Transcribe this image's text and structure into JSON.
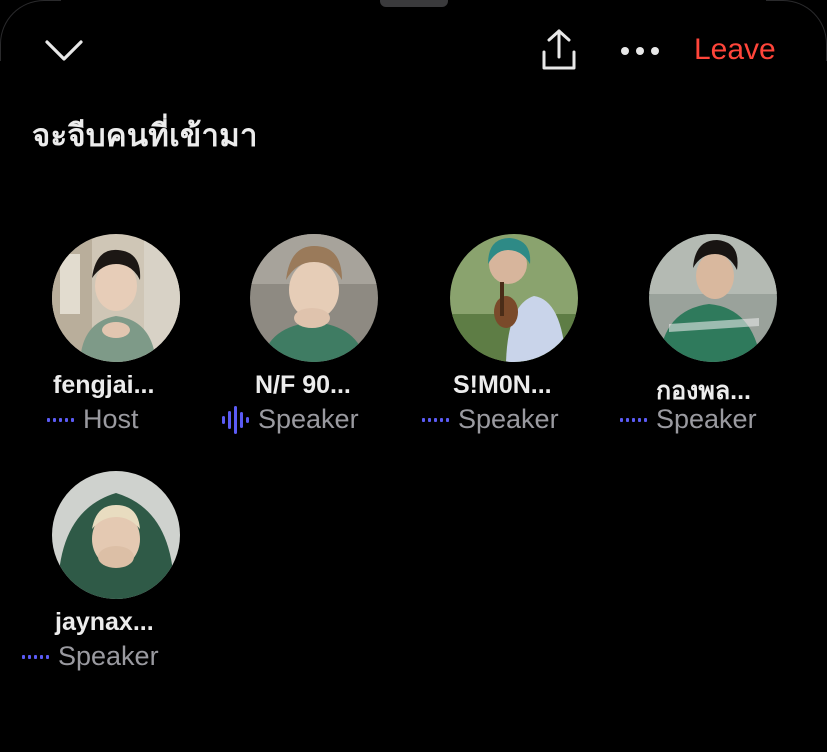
{
  "header": {
    "leave_label": "Leave"
  },
  "room": {
    "title": "จะจีบคนที่เข้ามา"
  },
  "participants": [
    {
      "name": "fengjai...",
      "role": "Host",
      "speaking": false
    },
    {
      "name": "N/F 90...",
      "role": "Speaker",
      "speaking": true
    },
    {
      "name": "S!M0N...",
      "role": "Speaker",
      "speaking": false
    },
    {
      "name": "กองพล...",
      "role": "Speaker",
      "speaking": false
    },
    {
      "name": "jaynax...",
      "role": "Speaker",
      "speaking": false
    }
  ],
  "colors": {
    "background": "#000000",
    "leave": "#ff453a",
    "wave": "#5b5bf5",
    "role_text": "#9a9aa0"
  },
  "icons": {
    "collapse": "chevron-down-icon",
    "share": "share-icon",
    "more": "more-icon",
    "audio": "audio-wave-icon"
  }
}
